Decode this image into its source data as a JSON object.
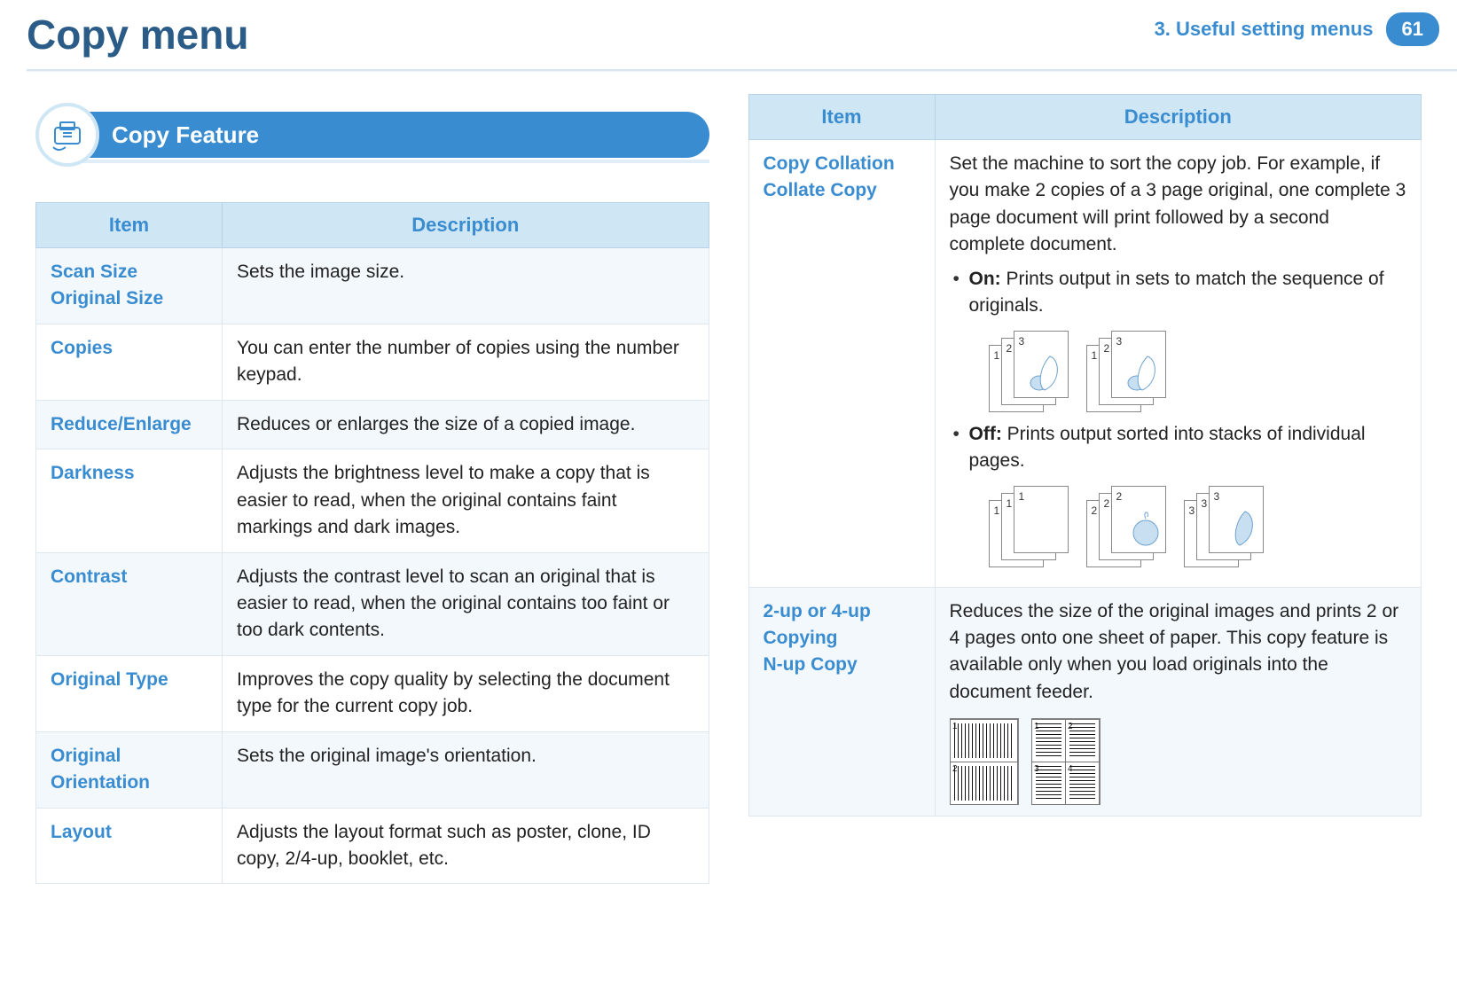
{
  "header": {
    "title": "Copy menu",
    "chapter": "3.   Useful setting menus",
    "page": "61"
  },
  "section_heading": "Copy Feature",
  "table_left": {
    "headers": {
      "item": "Item",
      "desc": "Description"
    },
    "rows": [
      {
        "item_a": "Scan Size",
        "item_b": "Original Size",
        "desc": "Sets the image size."
      },
      {
        "item_a": "Copies",
        "item_b": "",
        "desc": "You can enter the number of copies using the number keypad."
      },
      {
        "item_a": "Reduce/Enlarge",
        "item_b": "",
        "desc": "Reduces or enlarges the size of a copied image."
      },
      {
        "item_a": "Darkness",
        "item_b": "",
        "desc": "Adjusts the brightness level to make a copy that is easier to read, when the original contains faint markings and dark images."
      },
      {
        "item_a": "Contrast",
        "item_b": "",
        "desc": "Adjusts the contrast level to scan an original that is easier to read, when the original contains too faint or too dark contents."
      },
      {
        "item_a": "Original Type",
        "item_b": "",
        "desc": "Improves the copy quality by selecting the document type for the current copy job."
      },
      {
        "item_a": "Original Orientation",
        "item_b": "",
        "desc": "Sets the original image's orientation."
      },
      {
        "item_a": "Layout",
        "item_b": "",
        "desc": "Adjusts the layout format such as poster, clone, ID copy, 2/4-up, booklet, etc."
      }
    ]
  },
  "table_right": {
    "headers": {
      "item": "Item",
      "desc": "Description"
    },
    "collation": {
      "item_a": "Copy Collation",
      "item_b": "Collate Copy",
      "intro": "Set the machine to sort the copy job. For example, if you make 2 copies of a 3 page original, one complete 3 page document will print followed by a second complete document.",
      "on_label": "On:",
      "on_text": " Prints output in sets to match the sequence of originals.",
      "off_label": "Off:",
      "off_text": " Prints output sorted into stacks of individual pages."
    },
    "nup": {
      "item_a": "2-up or 4-up Copying",
      "item_b": "N-up Copy",
      "desc": "Reduces the size of the original images and prints 2 or 4 pages onto one sheet of paper. This copy feature is available only when you load originals into the document feeder."
    }
  }
}
